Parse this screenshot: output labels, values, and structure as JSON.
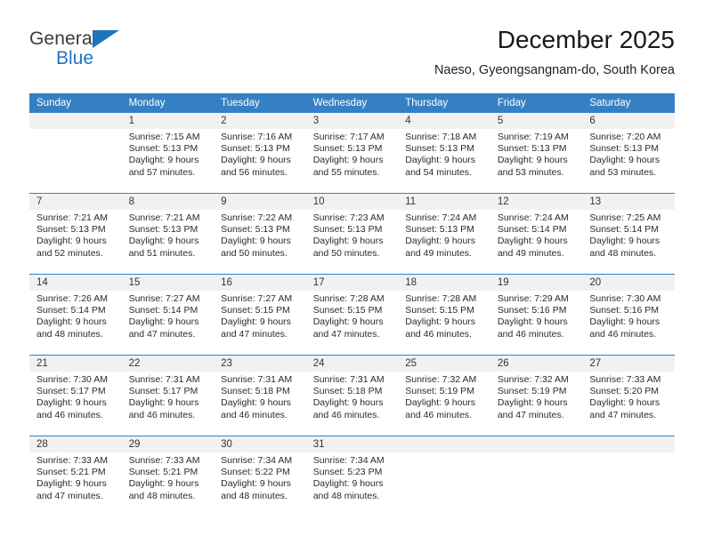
{
  "brand": {
    "name_top": "General",
    "name_bottom": "Blue",
    "triangle_icon": "triangle-icon",
    "color_blue": "#1f74bd",
    "color_dark": "#3b3b3b"
  },
  "header": {
    "title": "December 2025",
    "subtitle": "Naeso, Gyeongsangnam-do, South Korea"
  },
  "calendar": {
    "accent_color": "#3580c4",
    "daynum_band_color": "#f1f1f1",
    "weekday_headers": [
      "Sunday",
      "Monday",
      "Tuesday",
      "Wednesday",
      "Thursday",
      "Friday",
      "Saturday"
    ],
    "weeks": [
      [
        {
          "day": "",
          "sunrise": "",
          "sunset": "",
          "daylight_line1": "",
          "daylight_line2": ""
        },
        {
          "day": "1",
          "sunrise": "Sunrise: 7:15 AM",
          "sunset": "Sunset: 5:13 PM",
          "daylight_line1": "Daylight: 9 hours",
          "daylight_line2": "and 57 minutes."
        },
        {
          "day": "2",
          "sunrise": "Sunrise: 7:16 AM",
          "sunset": "Sunset: 5:13 PM",
          "daylight_line1": "Daylight: 9 hours",
          "daylight_line2": "and 56 minutes."
        },
        {
          "day": "3",
          "sunrise": "Sunrise: 7:17 AM",
          "sunset": "Sunset: 5:13 PM",
          "daylight_line1": "Daylight: 9 hours",
          "daylight_line2": "and 55 minutes."
        },
        {
          "day": "4",
          "sunrise": "Sunrise: 7:18 AM",
          "sunset": "Sunset: 5:13 PM",
          "daylight_line1": "Daylight: 9 hours",
          "daylight_line2": "and 54 minutes."
        },
        {
          "day": "5",
          "sunrise": "Sunrise: 7:19 AM",
          "sunset": "Sunset: 5:13 PM",
          "daylight_line1": "Daylight: 9 hours",
          "daylight_line2": "and 53 minutes."
        },
        {
          "day": "6",
          "sunrise": "Sunrise: 7:20 AM",
          "sunset": "Sunset: 5:13 PM",
          "daylight_line1": "Daylight: 9 hours",
          "daylight_line2": "and 53 minutes."
        }
      ],
      [
        {
          "day": "7",
          "sunrise": "Sunrise: 7:21 AM",
          "sunset": "Sunset: 5:13 PM",
          "daylight_line1": "Daylight: 9 hours",
          "daylight_line2": "and 52 minutes."
        },
        {
          "day": "8",
          "sunrise": "Sunrise: 7:21 AM",
          "sunset": "Sunset: 5:13 PM",
          "daylight_line1": "Daylight: 9 hours",
          "daylight_line2": "and 51 minutes."
        },
        {
          "day": "9",
          "sunrise": "Sunrise: 7:22 AM",
          "sunset": "Sunset: 5:13 PM",
          "daylight_line1": "Daylight: 9 hours",
          "daylight_line2": "and 50 minutes."
        },
        {
          "day": "10",
          "sunrise": "Sunrise: 7:23 AM",
          "sunset": "Sunset: 5:13 PM",
          "daylight_line1": "Daylight: 9 hours",
          "daylight_line2": "and 50 minutes."
        },
        {
          "day": "11",
          "sunrise": "Sunrise: 7:24 AM",
          "sunset": "Sunset: 5:13 PM",
          "daylight_line1": "Daylight: 9 hours",
          "daylight_line2": "and 49 minutes."
        },
        {
          "day": "12",
          "sunrise": "Sunrise: 7:24 AM",
          "sunset": "Sunset: 5:14 PM",
          "daylight_line1": "Daylight: 9 hours",
          "daylight_line2": "and 49 minutes."
        },
        {
          "day": "13",
          "sunrise": "Sunrise: 7:25 AM",
          "sunset": "Sunset: 5:14 PM",
          "daylight_line1": "Daylight: 9 hours",
          "daylight_line2": "and 48 minutes."
        }
      ],
      [
        {
          "day": "14",
          "sunrise": "Sunrise: 7:26 AM",
          "sunset": "Sunset: 5:14 PM",
          "daylight_line1": "Daylight: 9 hours",
          "daylight_line2": "and 48 minutes."
        },
        {
          "day": "15",
          "sunrise": "Sunrise: 7:27 AM",
          "sunset": "Sunset: 5:14 PM",
          "daylight_line1": "Daylight: 9 hours",
          "daylight_line2": "and 47 minutes."
        },
        {
          "day": "16",
          "sunrise": "Sunrise: 7:27 AM",
          "sunset": "Sunset: 5:15 PM",
          "daylight_line1": "Daylight: 9 hours",
          "daylight_line2": "and 47 minutes."
        },
        {
          "day": "17",
          "sunrise": "Sunrise: 7:28 AM",
          "sunset": "Sunset: 5:15 PM",
          "daylight_line1": "Daylight: 9 hours",
          "daylight_line2": "and 47 minutes."
        },
        {
          "day": "18",
          "sunrise": "Sunrise: 7:28 AM",
          "sunset": "Sunset: 5:15 PM",
          "daylight_line1": "Daylight: 9 hours",
          "daylight_line2": "and 46 minutes."
        },
        {
          "day": "19",
          "sunrise": "Sunrise: 7:29 AM",
          "sunset": "Sunset: 5:16 PM",
          "daylight_line1": "Daylight: 9 hours",
          "daylight_line2": "and 46 minutes."
        },
        {
          "day": "20",
          "sunrise": "Sunrise: 7:30 AM",
          "sunset": "Sunset: 5:16 PM",
          "daylight_line1": "Daylight: 9 hours",
          "daylight_line2": "and 46 minutes."
        }
      ],
      [
        {
          "day": "21",
          "sunrise": "Sunrise: 7:30 AM",
          "sunset": "Sunset: 5:17 PM",
          "daylight_line1": "Daylight: 9 hours",
          "daylight_line2": "and 46 minutes."
        },
        {
          "day": "22",
          "sunrise": "Sunrise: 7:31 AM",
          "sunset": "Sunset: 5:17 PM",
          "daylight_line1": "Daylight: 9 hours",
          "daylight_line2": "and 46 minutes."
        },
        {
          "day": "23",
          "sunrise": "Sunrise: 7:31 AM",
          "sunset": "Sunset: 5:18 PM",
          "daylight_line1": "Daylight: 9 hours",
          "daylight_line2": "and 46 minutes."
        },
        {
          "day": "24",
          "sunrise": "Sunrise: 7:31 AM",
          "sunset": "Sunset: 5:18 PM",
          "daylight_line1": "Daylight: 9 hours",
          "daylight_line2": "and 46 minutes."
        },
        {
          "day": "25",
          "sunrise": "Sunrise: 7:32 AM",
          "sunset": "Sunset: 5:19 PM",
          "daylight_line1": "Daylight: 9 hours",
          "daylight_line2": "and 46 minutes."
        },
        {
          "day": "26",
          "sunrise": "Sunrise: 7:32 AM",
          "sunset": "Sunset: 5:19 PM",
          "daylight_line1": "Daylight: 9 hours",
          "daylight_line2": "and 47 minutes."
        },
        {
          "day": "27",
          "sunrise": "Sunrise: 7:33 AM",
          "sunset": "Sunset: 5:20 PM",
          "daylight_line1": "Daylight: 9 hours",
          "daylight_line2": "and 47 minutes."
        }
      ],
      [
        {
          "day": "28",
          "sunrise": "Sunrise: 7:33 AM",
          "sunset": "Sunset: 5:21 PM",
          "daylight_line1": "Daylight: 9 hours",
          "daylight_line2": "and 47 minutes."
        },
        {
          "day": "29",
          "sunrise": "Sunrise: 7:33 AM",
          "sunset": "Sunset: 5:21 PM",
          "daylight_line1": "Daylight: 9 hours",
          "daylight_line2": "and 48 minutes."
        },
        {
          "day": "30",
          "sunrise": "Sunrise: 7:34 AM",
          "sunset": "Sunset: 5:22 PM",
          "daylight_line1": "Daylight: 9 hours",
          "daylight_line2": "and 48 minutes."
        },
        {
          "day": "31",
          "sunrise": "Sunrise: 7:34 AM",
          "sunset": "Sunset: 5:23 PM",
          "daylight_line1": "Daylight: 9 hours",
          "daylight_line2": "and 48 minutes."
        },
        {
          "day": "",
          "sunrise": "",
          "sunset": "",
          "daylight_line1": "",
          "daylight_line2": ""
        },
        {
          "day": "",
          "sunrise": "",
          "sunset": "",
          "daylight_line1": "",
          "daylight_line2": ""
        },
        {
          "day": "",
          "sunrise": "",
          "sunset": "",
          "daylight_line1": "",
          "daylight_line2": ""
        }
      ]
    ]
  }
}
